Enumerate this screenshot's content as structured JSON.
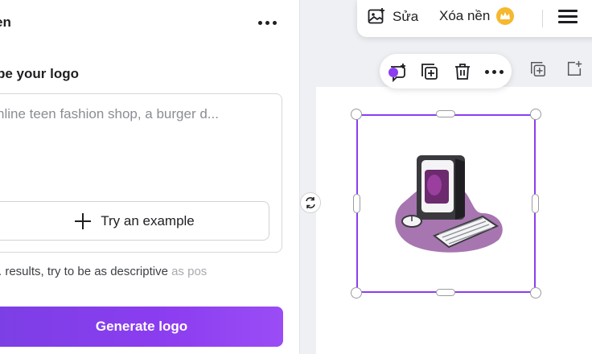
{
  "panel": {
    "title": "en",
    "section_label": "be your logo",
    "prompt_placeholder": "nline teen fashion shop, a burger d...",
    "example_button": "Try an example",
    "hint": ". results, try to be as descriptive",
    "hint_fade": " as pos",
    "generate_button": "Generate logo"
  },
  "toolbar": {
    "edit_label": "Sửa",
    "remove_bg_label": "Xóa nền"
  },
  "icons": {
    "edit": "edit-image-icon",
    "premium": "crown-icon",
    "menu": "hamburger-menu-icon",
    "comment": "add-comment-icon",
    "duplicate": "duplicate-icon",
    "delete": "trash-icon",
    "more": "more-icon",
    "rotate": "rotate-icon"
  },
  "colors": {
    "accent": "#8b3df0",
    "premium": "#f5b82e",
    "blob": "#a775b0"
  }
}
